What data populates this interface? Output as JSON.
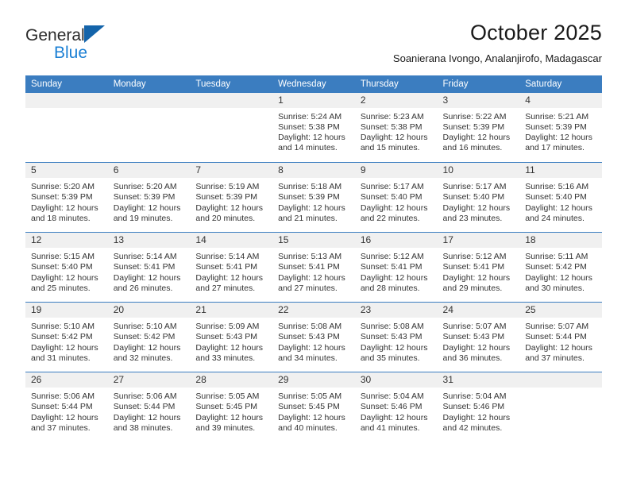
{
  "brand": {
    "name_part1": "General",
    "name_part2": "Blue",
    "logo_icon": "triangle-logo-icon",
    "accent_color": "#1a7fd4"
  },
  "header": {
    "title": "October 2025",
    "subtitle": "Soanierana Ivongo, Analanjirofo, Madagascar"
  },
  "calendar": {
    "header_bg": "#3b7dc0",
    "daynum_bg": "#f0f0f0",
    "weekdays": [
      "Sunday",
      "Monday",
      "Tuesday",
      "Wednesday",
      "Thursday",
      "Friday",
      "Saturday"
    ],
    "labels": {
      "sunrise": "Sunrise:",
      "sunset": "Sunset:",
      "daylight": "Daylight:"
    },
    "weeks": [
      [
        {
          "day": "",
          "empty": true
        },
        {
          "day": "",
          "empty": true
        },
        {
          "day": "",
          "empty": true
        },
        {
          "day": "1",
          "sunrise": "Sunrise: 5:24 AM",
          "sunset": "Sunset: 5:38 PM",
          "daylight": "Daylight: 12 hours and 14 minutes."
        },
        {
          "day": "2",
          "sunrise": "Sunrise: 5:23 AM",
          "sunset": "Sunset: 5:38 PM",
          "daylight": "Daylight: 12 hours and 15 minutes."
        },
        {
          "day": "3",
          "sunrise": "Sunrise: 5:22 AM",
          "sunset": "Sunset: 5:39 PM",
          "daylight": "Daylight: 12 hours and 16 minutes."
        },
        {
          "day": "4",
          "sunrise": "Sunrise: 5:21 AM",
          "sunset": "Sunset: 5:39 PM",
          "daylight": "Daylight: 12 hours and 17 minutes."
        }
      ],
      [
        {
          "day": "5",
          "sunrise": "Sunrise: 5:20 AM",
          "sunset": "Sunset: 5:39 PM",
          "daylight": "Daylight: 12 hours and 18 minutes."
        },
        {
          "day": "6",
          "sunrise": "Sunrise: 5:20 AM",
          "sunset": "Sunset: 5:39 PM",
          "daylight": "Daylight: 12 hours and 19 minutes."
        },
        {
          "day": "7",
          "sunrise": "Sunrise: 5:19 AM",
          "sunset": "Sunset: 5:39 PM",
          "daylight": "Daylight: 12 hours and 20 minutes."
        },
        {
          "day": "8",
          "sunrise": "Sunrise: 5:18 AM",
          "sunset": "Sunset: 5:39 PM",
          "daylight": "Daylight: 12 hours and 21 minutes."
        },
        {
          "day": "9",
          "sunrise": "Sunrise: 5:17 AM",
          "sunset": "Sunset: 5:40 PM",
          "daylight": "Daylight: 12 hours and 22 minutes."
        },
        {
          "day": "10",
          "sunrise": "Sunrise: 5:17 AM",
          "sunset": "Sunset: 5:40 PM",
          "daylight": "Daylight: 12 hours and 23 minutes."
        },
        {
          "day": "11",
          "sunrise": "Sunrise: 5:16 AM",
          "sunset": "Sunset: 5:40 PM",
          "daylight": "Daylight: 12 hours and 24 minutes."
        }
      ],
      [
        {
          "day": "12",
          "sunrise": "Sunrise: 5:15 AM",
          "sunset": "Sunset: 5:40 PM",
          "daylight": "Daylight: 12 hours and 25 minutes."
        },
        {
          "day": "13",
          "sunrise": "Sunrise: 5:14 AM",
          "sunset": "Sunset: 5:41 PM",
          "daylight": "Daylight: 12 hours and 26 minutes."
        },
        {
          "day": "14",
          "sunrise": "Sunrise: 5:14 AM",
          "sunset": "Sunset: 5:41 PM",
          "daylight": "Daylight: 12 hours and 27 minutes."
        },
        {
          "day": "15",
          "sunrise": "Sunrise: 5:13 AM",
          "sunset": "Sunset: 5:41 PM",
          "daylight": "Daylight: 12 hours and 27 minutes."
        },
        {
          "day": "16",
          "sunrise": "Sunrise: 5:12 AM",
          "sunset": "Sunset: 5:41 PM",
          "daylight": "Daylight: 12 hours and 28 minutes."
        },
        {
          "day": "17",
          "sunrise": "Sunrise: 5:12 AM",
          "sunset": "Sunset: 5:41 PM",
          "daylight": "Daylight: 12 hours and 29 minutes."
        },
        {
          "day": "18",
          "sunrise": "Sunrise: 5:11 AM",
          "sunset": "Sunset: 5:42 PM",
          "daylight": "Daylight: 12 hours and 30 minutes."
        }
      ],
      [
        {
          "day": "19",
          "sunrise": "Sunrise: 5:10 AM",
          "sunset": "Sunset: 5:42 PM",
          "daylight": "Daylight: 12 hours and 31 minutes."
        },
        {
          "day": "20",
          "sunrise": "Sunrise: 5:10 AM",
          "sunset": "Sunset: 5:42 PM",
          "daylight": "Daylight: 12 hours and 32 minutes."
        },
        {
          "day": "21",
          "sunrise": "Sunrise: 5:09 AM",
          "sunset": "Sunset: 5:43 PM",
          "daylight": "Daylight: 12 hours and 33 minutes."
        },
        {
          "day": "22",
          "sunrise": "Sunrise: 5:08 AM",
          "sunset": "Sunset: 5:43 PM",
          "daylight": "Daylight: 12 hours and 34 minutes."
        },
        {
          "day": "23",
          "sunrise": "Sunrise: 5:08 AM",
          "sunset": "Sunset: 5:43 PM",
          "daylight": "Daylight: 12 hours and 35 minutes."
        },
        {
          "day": "24",
          "sunrise": "Sunrise: 5:07 AM",
          "sunset": "Sunset: 5:43 PM",
          "daylight": "Daylight: 12 hours and 36 minutes."
        },
        {
          "day": "25",
          "sunrise": "Sunrise: 5:07 AM",
          "sunset": "Sunset: 5:44 PM",
          "daylight": "Daylight: 12 hours and 37 minutes."
        }
      ],
      [
        {
          "day": "26",
          "sunrise": "Sunrise: 5:06 AM",
          "sunset": "Sunset: 5:44 PM",
          "daylight": "Daylight: 12 hours and 37 minutes."
        },
        {
          "day": "27",
          "sunrise": "Sunrise: 5:06 AM",
          "sunset": "Sunset: 5:44 PM",
          "daylight": "Daylight: 12 hours and 38 minutes."
        },
        {
          "day": "28",
          "sunrise": "Sunrise: 5:05 AM",
          "sunset": "Sunset: 5:45 PM",
          "daylight": "Daylight: 12 hours and 39 minutes."
        },
        {
          "day": "29",
          "sunrise": "Sunrise: 5:05 AM",
          "sunset": "Sunset: 5:45 PM",
          "daylight": "Daylight: 12 hours and 40 minutes."
        },
        {
          "day": "30",
          "sunrise": "Sunrise: 5:04 AM",
          "sunset": "Sunset: 5:46 PM",
          "daylight": "Daylight: 12 hours and 41 minutes."
        },
        {
          "day": "31",
          "sunrise": "Sunrise: 5:04 AM",
          "sunset": "Sunset: 5:46 PM",
          "daylight": "Daylight: 12 hours and 42 minutes."
        },
        {
          "day": "",
          "empty": true
        }
      ]
    ]
  }
}
